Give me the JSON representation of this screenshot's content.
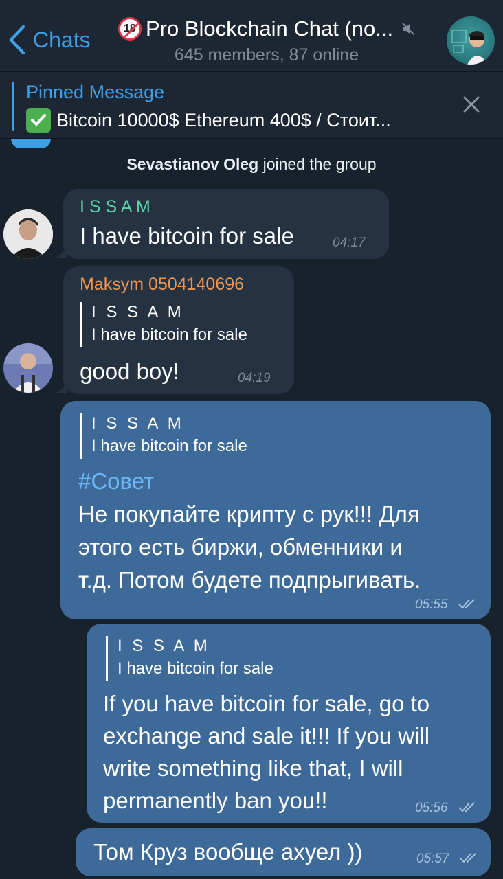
{
  "header": {
    "back_label": "Chats",
    "badge": "18",
    "title": "Pro Blockchain Chat (no...",
    "subtitle": "645 members, 87 online"
  },
  "pinned": {
    "title": "Pinned Message",
    "text": "Bitcoin 10000$ Ethereum 400$ / Стоит..."
  },
  "service_message": {
    "name": "Sevastianov Oleg",
    "action": " joined the group"
  },
  "messages": [
    {
      "sender": "I S S A M",
      "text": "I have bitcoin for sale",
      "time": "04:17"
    },
    {
      "sender": "Maksym 0504140696",
      "reply_name": "I S S A M",
      "reply_text": "I have bitcoin for sale",
      "text": "good boy!",
      "time": "04:19"
    },
    {
      "reply_name": "I S S A M",
      "reply_text": "I have bitcoin for sale",
      "hashtag": "#Совет",
      "text_lines": [
        "Не покупайте крипту с рук!!! Для",
        "этого есть биржи, обменники и",
        "т.д. Потом будете подпрыгивать."
      ],
      "time": "05:55"
    },
    {
      "reply_name": "I S S A M",
      "reply_text": "I have bitcoin for sale",
      "text_lines": [
        "If you have bitcoin for sale, go to",
        "exchange and sale it!!! If you will",
        "write something like that, I will",
        "permanently ban you!!"
      ],
      "time": "05:56"
    },
    {
      "text": "Том Круз вообще ахуел ))",
      "time": "05:57"
    }
  ],
  "colors": {
    "background": "#18222d",
    "header": "#1d2733",
    "accent": "#3d9fe7",
    "incoming_bubble": "#243242",
    "outgoing_bubble": "#3e6a99",
    "issam_name": "#5ad0a8",
    "maksym_name": "#f0954e"
  }
}
